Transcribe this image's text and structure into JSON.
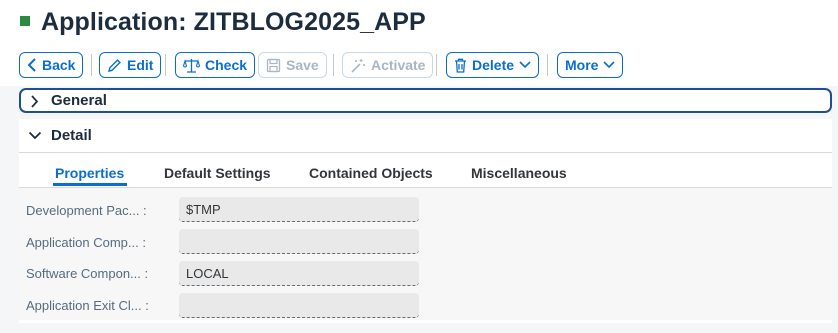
{
  "page": {
    "title": "Application: ZITBLOG2025_APP"
  },
  "toolbar": {
    "back_label": "Back",
    "edit_label": "Edit",
    "check_label": "Check",
    "save_label": "Save",
    "activate_label": "Activate",
    "delete_label": "Delete",
    "more_label": "More"
  },
  "panels": {
    "general": "General",
    "detail": "Detail"
  },
  "tabs": [
    {
      "label": "Properties",
      "active": true
    },
    {
      "label": "Default Settings",
      "active": false
    },
    {
      "label": "Contained Objects",
      "active": false
    },
    {
      "label": "Miscellaneous",
      "active": false
    }
  ],
  "fields": [
    {
      "label": "Development Pac... :",
      "value": "$TMP"
    },
    {
      "label": "Application Comp... :",
      "value": ""
    },
    {
      "label": "Software Compon... :",
      "value": "LOCAL"
    },
    {
      "label": "Application Exit Cl... :",
      "value": ""
    }
  ],
  "colors": {
    "accent": "#0a6ed1",
    "status_square": "#2b8a3e",
    "focus_border": "#1d4f91"
  }
}
